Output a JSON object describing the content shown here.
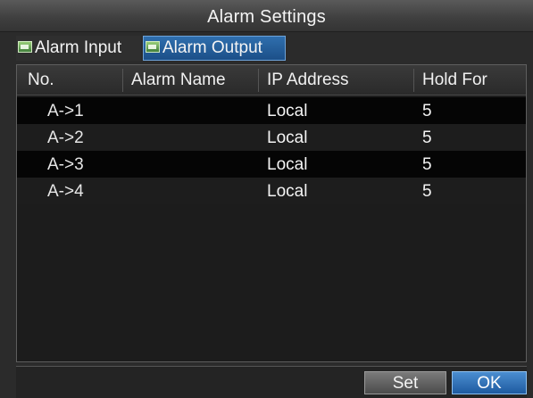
{
  "window": {
    "title": "Alarm Settings"
  },
  "tabs": [
    {
      "label": "Alarm Input",
      "icon": "alarm-input-icon",
      "active": false
    },
    {
      "label": "Alarm Output",
      "icon": "alarm-output-icon",
      "active": true
    }
  ],
  "table": {
    "columns": [
      "No.",
      "Alarm Name",
      "IP Address",
      "Hold For"
    ],
    "rows": [
      {
        "no": "A->1",
        "name": "",
        "ip": "Local",
        "hold": "5"
      },
      {
        "no": "A->2",
        "name": "",
        "ip": "Local",
        "hold": "5"
      },
      {
        "no": "A->3",
        "name": "",
        "ip": "Local",
        "hold": "5"
      },
      {
        "no": "A->4",
        "name": "",
        "ip": "Local",
        "hold": "5"
      }
    ]
  },
  "buttons": {
    "set": "Set",
    "ok": "OK"
  },
  "colors": {
    "active_tab": "#1c4f88",
    "ok_button": "#1e5aa0",
    "panel_bg": "#1c1c1c"
  }
}
